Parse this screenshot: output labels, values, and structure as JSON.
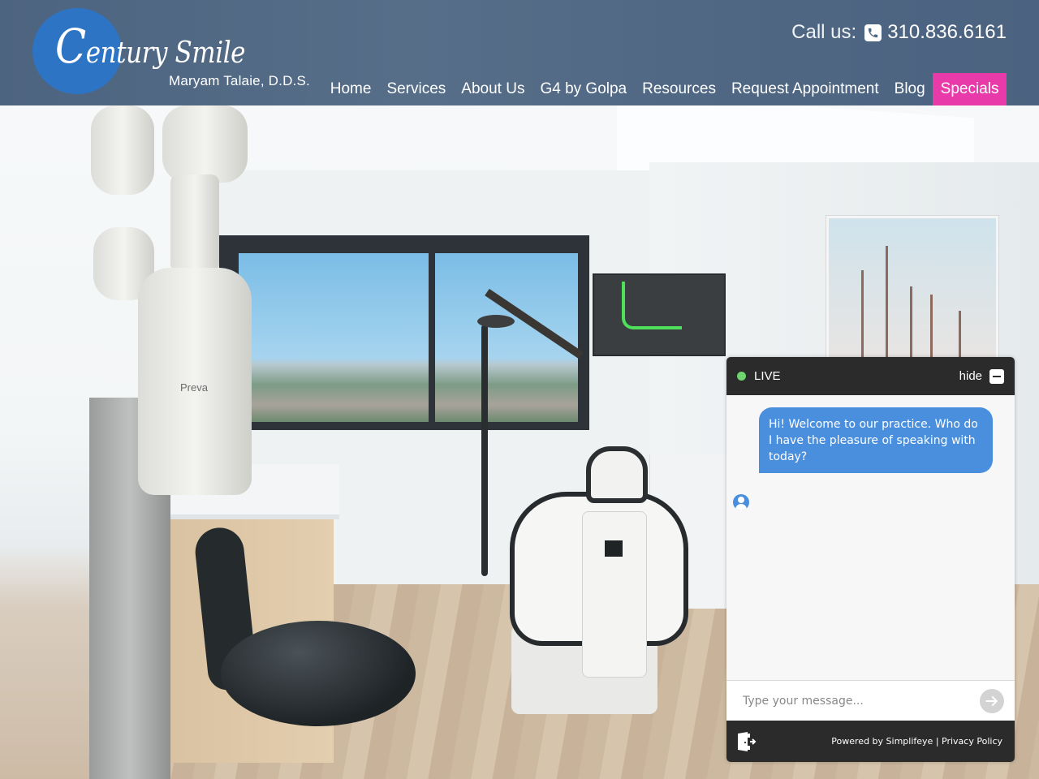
{
  "header": {
    "logo": {
      "script_text_first": "C",
      "script_text_rest": "entury Smile",
      "subtitle": "Maryam Talaie, D.D.S."
    },
    "call": {
      "label": "Call us:",
      "icon": "phone-icon",
      "phone": "310.836.6161"
    },
    "nav": [
      {
        "label": "Home",
        "active": false
      },
      {
        "label": "Services",
        "active": false
      },
      {
        "label": "About Us",
        "active": false
      },
      {
        "label": "G4 by Golpa",
        "active": false
      },
      {
        "label": "Resources",
        "active": false
      },
      {
        "label": "Request Appointment",
        "active": false
      },
      {
        "label": "Blog",
        "active": false
      },
      {
        "label": "Specials",
        "active": true
      }
    ]
  },
  "hero": {
    "image_description": "Dental operatory with Preva x-ray arm, patient chair, window city view",
    "xray_label": "Preva"
  },
  "chat": {
    "status_label": "LIVE",
    "status_color": "#6fd46f",
    "hide_label": "hide",
    "messages": [
      {
        "from": "agent",
        "text": "Hi! Welcome to our practice.  Who do I have the pleasure of speaking with today?"
      }
    ],
    "input_placeholder": "Type your message...",
    "input_value": "",
    "footer": {
      "powered_by": "Powered by Simplifeye",
      "separator": "|",
      "privacy_link": "Privacy Policy"
    }
  },
  "colors": {
    "header_bg": "#4f6783",
    "logo_circle": "#2d74c4",
    "specials_accent": "#e93aa9",
    "chat_bubble": "#4a8fdd",
    "chat_dark": "#2b2b2b"
  }
}
